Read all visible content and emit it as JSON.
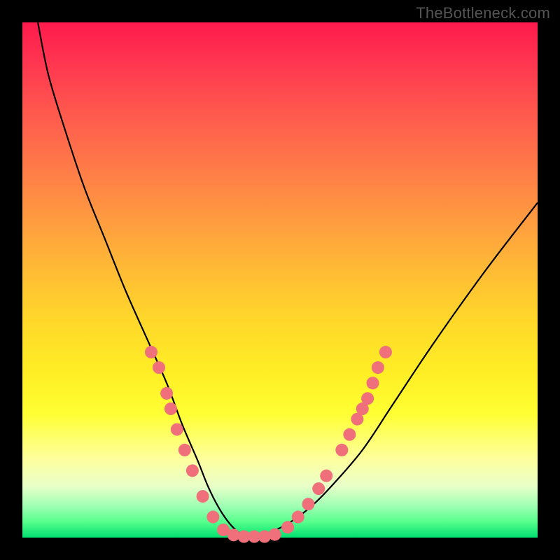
{
  "watermark": "TheBottleneck.com",
  "chart_data": {
    "type": "line",
    "title": "",
    "xlabel": "",
    "ylabel": "",
    "xlim": [
      0,
      100
    ],
    "ylim": [
      0,
      100
    ],
    "series": [
      {
        "name": "left-curve",
        "x": [
          3,
          5,
          8,
          12,
          16,
          20,
          24,
          28,
          31,
          34,
          36,
          38,
          40,
          42,
          44
        ],
        "y": [
          100,
          90,
          80,
          68,
          58,
          48,
          39,
          30,
          22,
          15,
          10,
          6,
          3,
          1,
          0
        ]
      },
      {
        "name": "right-curve",
        "x": [
          44,
          48,
          52,
          56,
          60,
          66,
          72,
          80,
          90,
          100
        ],
        "y": [
          0,
          1,
          3,
          6,
          10,
          17,
          26,
          38,
          52,
          65
        ]
      }
    ],
    "flat_region": {
      "x_start": 40,
      "x_end": 50,
      "y": 0
    },
    "markers": {
      "name": "dots",
      "color": "#ef6f7a",
      "radius": 9,
      "points": [
        {
          "x": 25.0,
          "y": 36
        },
        {
          "x": 26.5,
          "y": 33
        },
        {
          "x": 28.0,
          "y": 28
        },
        {
          "x": 28.8,
          "y": 25
        },
        {
          "x": 30.0,
          "y": 21
        },
        {
          "x": 31.5,
          "y": 17
        },
        {
          "x": 33.0,
          "y": 13
        },
        {
          "x": 35.0,
          "y": 8
        },
        {
          "x": 37.0,
          "y": 4
        },
        {
          "x": 39.0,
          "y": 1.5
        },
        {
          "x": 41.0,
          "y": 0.5
        },
        {
          "x": 43.0,
          "y": 0.2
        },
        {
          "x": 45.0,
          "y": 0.2
        },
        {
          "x": 47.0,
          "y": 0.2
        },
        {
          "x": 49.0,
          "y": 0.6
        },
        {
          "x": 51.5,
          "y": 2
        },
        {
          "x": 53.5,
          "y": 4
        },
        {
          "x": 55.5,
          "y": 6.5
        },
        {
          "x": 57.5,
          "y": 9.5
        },
        {
          "x": 59.0,
          "y": 12
        },
        {
          "x": 62.0,
          "y": 17
        },
        {
          "x": 63.5,
          "y": 20
        },
        {
          "x": 65.0,
          "y": 23
        },
        {
          "x": 66.0,
          "y": 25
        },
        {
          "x": 67.0,
          "y": 27
        },
        {
          "x": 68.0,
          "y": 30
        },
        {
          "x": 69.0,
          "y": 33
        },
        {
          "x": 70.5,
          "y": 36
        }
      ]
    }
  }
}
